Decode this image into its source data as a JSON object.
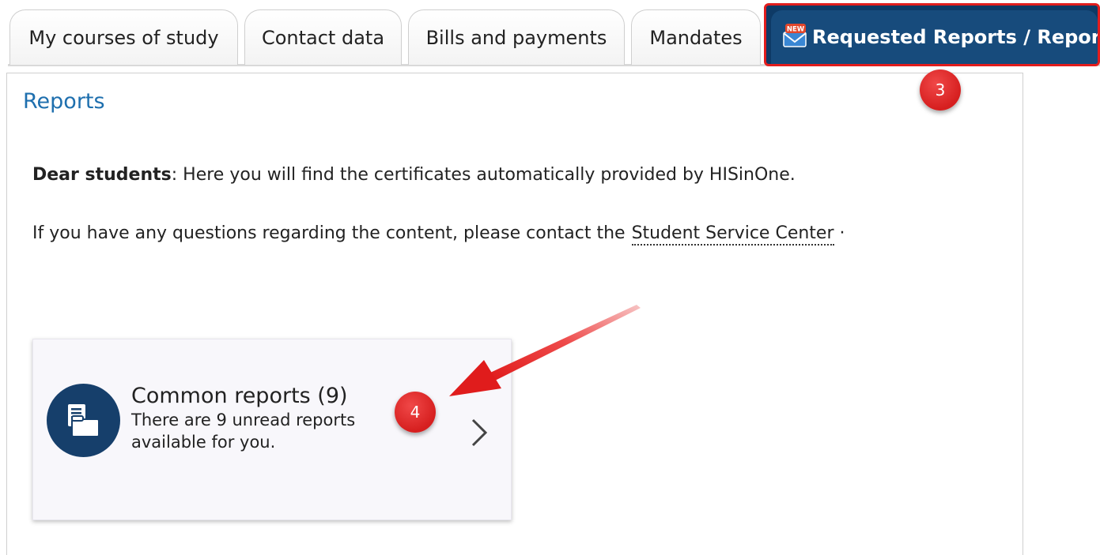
{
  "tabs": {
    "items": [
      {
        "label": "My courses of study"
      },
      {
        "label": "Contact data"
      },
      {
        "label": "Bills and payments"
      },
      {
        "label": "Mandates"
      }
    ],
    "active": {
      "label": "Requested Reports / Reports",
      "icon": "new-envelope-icon"
    }
  },
  "content": {
    "title": "Reports",
    "intro_bold": "Dear students",
    "intro_rest": ": Here you will find the certificates automatically provided by HISinOne.",
    "contact_text": "If you have any questions regarding the content, please contact the",
    "contact_link": "Student Service Center",
    "contact_end": " ·"
  },
  "card": {
    "title": "Common reports (9)",
    "description": "There are 9 unread reports available for you.",
    "icon": "documents-icon",
    "chevron": "chevron-right-icon"
  },
  "annotations": {
    "step3": "3",
    "step4": "4"
  },
  "colors": {
    "accent_blue": "#1e6fae",
    "active_tab": "#174b7c",
    "highlight_red": "#e21d1d",
    "badge_red": "#d61f1f"
  }
}
